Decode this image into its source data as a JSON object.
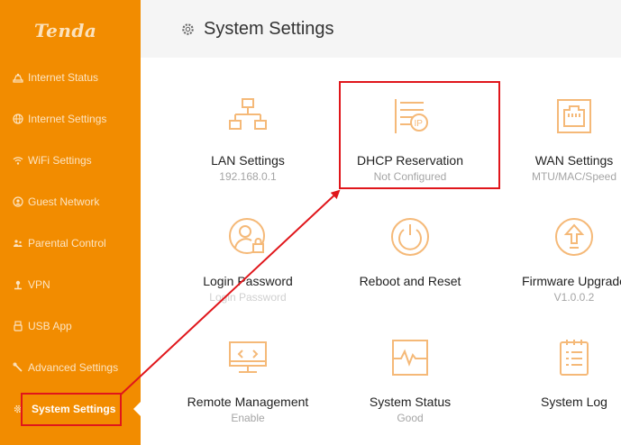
{
  "sidebar": {
    "logo": "Tenda",
    "items": [
      {
        "label": "Internet Status",
        "icon": "internet-status-icon"
      },
      {
        "label": "Internet Settings",
        "icon": "globe-icon"
      },
      {
        "label": "WiFi Settings",
        "icon": "wifi-icon"
      },
      {
        "label": "Guest Network",
        "icon": "guest-network-icon"
      },
      {
        "label": "Parental Control",
        "icon": "parental-control-icon"
      },
      {
        "label": "VPN",
        "icon": "vpn-icon"
      },
      {
        "label": "USB App",
        "icon": "usb-icon"
      },
      {
        "label": "Advanced Settings",
        "icon": "wrench-icon"
      },
      {
        "label": "System Settings",
        "icon": "gear-icon",
        "active": true
      }
    ]
  },
  "header": {
    "title": "System Settings",
    "icon": "gear-icon"
  },
  "tiles": [
    {
      "label": "LAN Settings",
      "sub": "192.168.0.1",
      "icon": "lan-icon"
    },
    {
      "label": "DHCP Reservation",
      "sub": "Not Configured",
      "icon": "dhcp-reservation-icon"
    },
    {
      "label": "WAN Settings",
      "sub": "MTU/MAC/Speed",
      "icon": "wan-port-icon"
    },
    {
      "label": "Login Password",
      "sub": "Login Password",
      "icon": "login-password-icon"
    },
    {
      "label": "Reboot and Reset",
      "sub": "",
      "icon": "power-icon"
    },
    {
      "label": "Firmware Upgrade",
      "sub": "V1.0.0.2",
      "icon": "firmware-upgrade-icon"
    },
    {
      "label": "Remote Management",
      "sub": "Enable",
      "icon": "remote-management-icon"
    },
    {
      "label": "System Status",
      "sub": "Good",
      "icon": "system-status-icon"
    },
    {
      "label": "System Log",
      "sub": "",
      "icon": "system-log-icon"
    }
  ],
  "colors": {
    "sidebar_bg": "#f28c00",
    "accent_icon": "#f5b978",
    "annotation_red": "#e0161b",
    "header_bg": "#f5f5f5"
  }
}
